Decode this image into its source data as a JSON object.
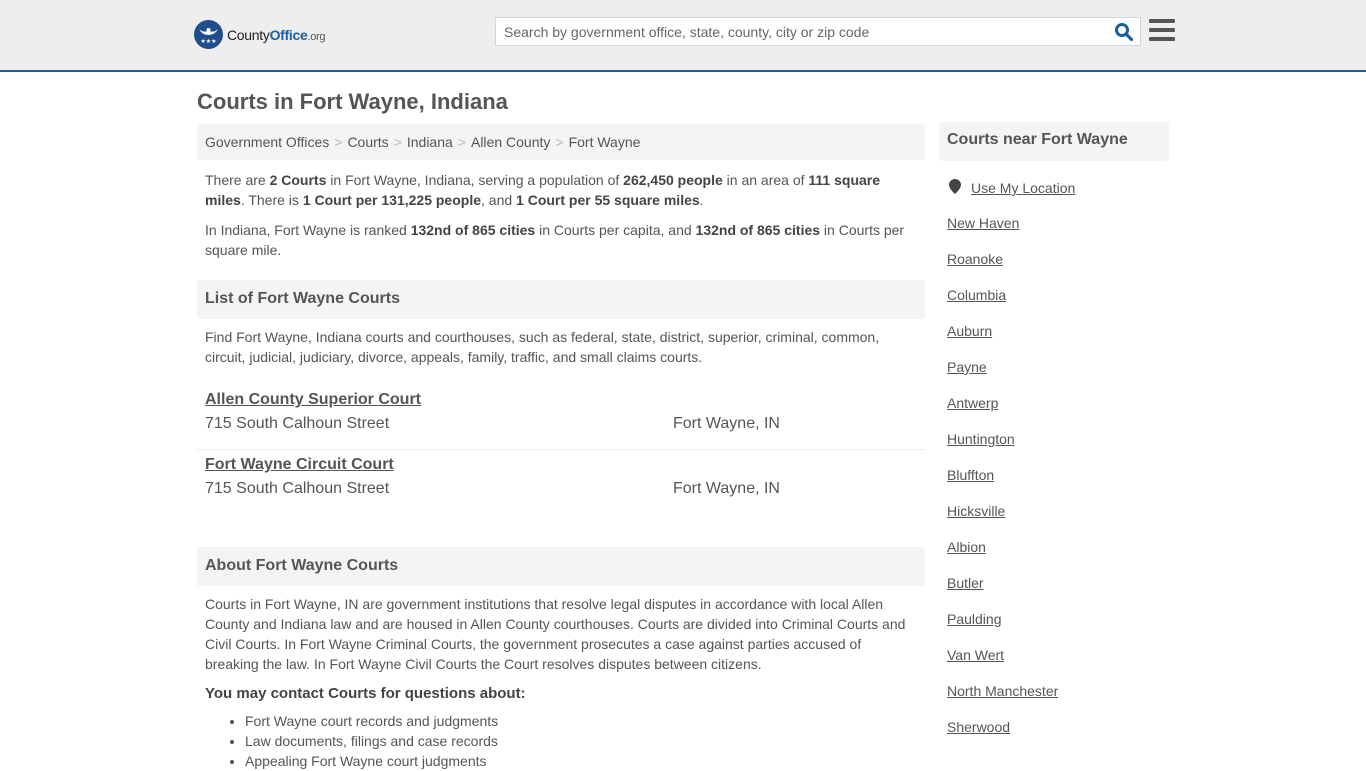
{
  "header": {
    "logo": {
      "part1": "County",
      "part2": "Office",
      "part3": ".org"
    },
    "search_placeholder": "Search by government office, state, county, city or zip code",
    "search_icon": "search-icon",
    "menu_icon": "hamburger-menu-icon",
    "accent_color": "#1a5ea0"
  },
  "page_title": "Courts in Fort Wayne, Indiana",
  "breadcrumb": [
    "Government Offices",
    "Courts",
    "Indiana",
    "Allen County",
    "Fort Wayne"
  ],
  "intro": {
    "p1": {
      "t1": "There are ",
      "b1": "2 Courts",
      "t2": " in Fort Wayne, Indiana, serving a population of ",
      "b2": "262,450 people",
      "t3": " in an area of ",
      "b3": "111 square miles",
      "t4": ". There is ",
      "b4": "1 Court per 131,225 people",
      "t5": ", and ",
      "b5": "1 Court per 55 square miles",
      "t6": "."
    },
    "p2": {
      "t1": "In Indiana, Fort Wayne is ranked ",
      "b1": "132nd of 865 cities",
      "t2": " in Courts per capita, and ",
      "b2": "132nd of 865 cities",
      "t3": " in Courts per square mile."
    }
  },
  "list_section": {
    "heading": "List of Fort Wayne Courts",
    "description": "Find Fort Wayne, Indiana courts and courthouses, such as federal, state, district, superior, criminal, common, circuit, judicial, judiciary, divorce, appeals, family, traffic, and small claims courts.",
    "courts": [
      {
        "name": "Allen County Superior Court",
        "address": "715 South Calhoun Street",
        "city": "Fort Wayne, IN"
      },
      {
        "name": "Fort Wayne Circuit Court",
        "address": "715 South Calhoun Street",
        "city": "Fort Wayne, IN"
      }
    ]
  },
  "about_section": {
    "heading": "About Fort Wayne Courts",
    "body": "Courts in Fort Wayne, IN are government institutions that resolve legal disputes in accordance with local Allen County and Indiana law and are housed in Allen County courthouses. Courts are divided into Criminal Courts and Civil Courts. In Fort Wayne Criminal Courts, the government prosecutes a case against parties accused of breaking the law. In Fort Wayne Civil Courts the Court resolves disputes between citizens.",
    "contact_heading": "You may contact Courts for questions about:",
    "contact_items": [
      "Fort Wayne court records and judgments",
      "Law documents, filings and case records",
      "Appealing Fort Wayne court judgments"
    ]
  },
  "sidebar": {
    "heading": "Courts near Fort Wayne",
    "use_location": "Use My Location",
    "location_icon": "map-pin-icon",
    "cities": [
      "New Haven",
      "Roanoke",
      "Columbia",
      "Auburn",
      "Payne",
      "Antwerp",
      "Huntington",
      "Bluffton",
      "Hicksville",
      "Albion",
      "Butler",
      "Paulding",
      "Van Wert",
      "North Manchester",
      "Sherwood"
    ]
  }
}
